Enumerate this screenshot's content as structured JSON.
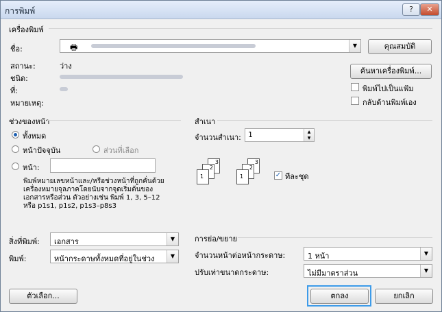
{
  "window": {
    "title": "การพิมพ์",
    "help_label": "?",
    "close_label": "✕"
  },
  "printer": {
    "group_title": "เครื่องพิมพ์",
    "name_label": "ชื่อ:",
    "status_label": "สถานะ:",
    "status_value": "ว่าง",
    "type_label": "ชนิด:",
    "where_label": "ที่:",
    "comment_label": "หมายเหตุ:",
    "properties_button": "คุณสมบัติ",
    "find_printer_button": "ค้นหาเครื่องพิมพ์...",
    "print_to_file_label": "พิมพ์ไปเป็นแฟ้ม",
    "manual_duplex_label": "กลับด้านพิมพ์เอง"
  },
  "page_range": {
    "group_title": "ช่วงของหน้า",
    "all_label": "ทั้งหมด",
    "current_label": "หน้าปัจจุบัน",
    "selection_label": "ส่วนที่เลือก",
    "pages_label": "หน้า:",
    "hint": "พิมพ์หมายเลขหน้าและ/หรือช่วงหน้าที่ถูกคั่นด้วยเครื่องหมายจุลภาคโดยนับจากจุดเริ่มต้นของเอกสารหรือส่วน ตัวอย่างเช่น พิมพ์ 1, 3, 5–12 หรือ p1s1, p1s2, p1s3–p8s3"
  },
  "copies": {
    "group_title": "สำเนา",
    "count_label": "จำนวนสำเนา:",
    "count_value": "1",
    "collate_label": "ทีละชุด",
    "page_numbers": [
      "3",
      "2",
      "1",
      "3",
      "2",
      "1"
    ]
  },
  "print_what": {
    "label": "สิ่งที่พิมพ์:",
    "value": "เอกสาร"
  },
  "print": {
    "label": "พิมพ์:",
    "value": "หน้ากระดาษทั้งหมดที่อยู่ในช่วง"
  },
  "zoom": {
    "group_title": "การย่อ/ขยาย",
    "pages_per_sheet_label": "จำนวนหน้าต่อหน้ากระดาษ:",
    "pages_per_sheet_value": "1 หน้า",
    "scale_label": "ปรับเท่าขนาดกระดาษ:",
    "scale_value": "ไม่มีมาตราส่วน"
  },
  "footer": {
    "options_button": "ตัวเลือก...",
    "ok_button": "ตกลง",
    "cancel_button": "ยกเลิก"
  },
  "colors": {
    "accent": "#1c5fb0",
    "focus": "#3d9be9"
  }
}
